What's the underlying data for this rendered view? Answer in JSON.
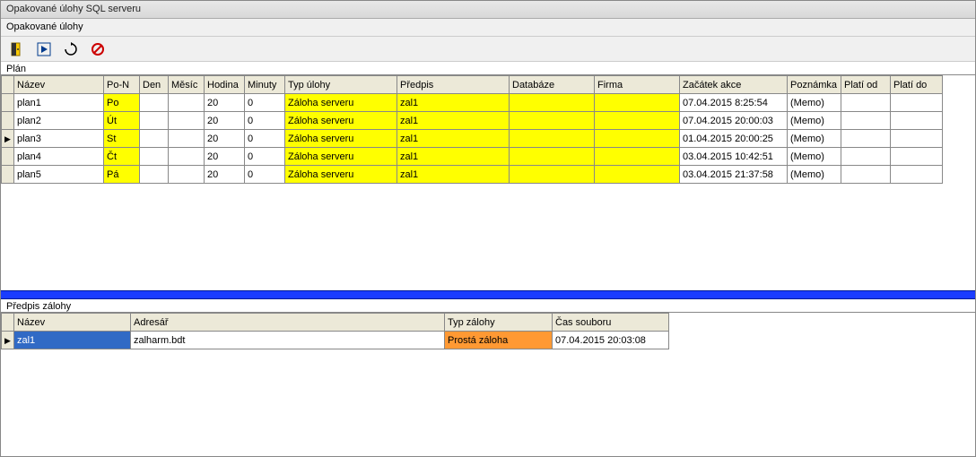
{
  "window": {
    "title": "Opakované úlohy SQL serveru"
  },
  "menu": {
    "item1": "Opakované úlohy"
  },
  "icons": {
    "exit": "exit-door-icon",
    "run": "run-forward-icon",
    "refresh": "refresh-icon",
    "forbid": "no-entry-icon"
  },
  "section1_label": "Plán",
  "grid1": {
    "headers": [
      "Název",
      "Po-N",
      "Den",
      "Měsíc",
      "Hodina",
      "Minuty",
      "Typ úlohy",
      "Předpis",
      "Databáze",
      "Firma",
      "Začátek akce",
      "Poznámka",
      "Platí od",
      "Platí do"
    ],
    "rows": [
      {
        "marker": false,
        "nazev": "plan1",
        "pon": "Po",
        "den": "",
        "mesic": "",
        "hod": "20",
        "min": "0",
        "typ": "Záloha serveru",
        "predpis": "zal1",
        "db": "",
        "firma": "",
        "start": "07.04.2015 8:25:54",
        "pozn": "(Memo)",
        "od": "",
        "do": ""
      },
      {
        "marker": false,
        "nazev": "plan2",
        "pon": "Út",
        "den": "",
        "mesic": "",
        "hod": "20",
        "min": "0",
        "typ": "Záloha serveru",
        "predpis": "zal1",
        "db": "",
        "firma": "",
        "start": "07.04.2015 20:00:03",
        "pozn": "(Memo)",
        "od": "",
        "do": ""
      },
      {
        "marker": true,
        "nazev": "plan3",
        "pon": "St",
        "den": "",
        "mesic": "",
        "hod": "20",
        "min": "0",
        "typ": "Záloha serveru",
        "predpis": "zal1",
        "db": "",
        "firma": "",
        "start": "01.04.2015 20:00:25",
        "pozn": "(Memo)",
        "od": "",
        "do": ""
      },
      {
        "marker": false,
        "nazev": "plan4",
        "pon": "Čt",
        "den": "",
        "mesic": "",
        "hod": "20",
        "min": "0",
        "typ": "Záloha serveru",
        "predpis": "zal1",
        "db": "",
        "firma": "",
        "start": "03.04.2015 10:42:51",
        "pozn": "(Memo)",
        "od": "",
        "do": ""
      },
      {
        "marker": false,
        "nazev": "plan5",
        "pon": "Pá",
        "den": "",
        "mesic": "",
        "hod": "20",
        "min": "0",
        "typ": "Záloha serveru",
        "predpis": "zal1",
        "db": "",
        "firma": "",
        "start": "03.04.2015 21:37:58",
        "pozn": "(Memo)",
        "od": "",
        "do": ""
      }
    ]
  },
  "section2_label": "Předpis zálohy",
  "grid2": {
    "headers": [
      "Název",
      "Adresář",
      "Typ zálohy",
      "Čas souboru"
    ],
    "rows": [
      {
        "marker": true,
        "nazev": "zal1",
        "adresar": "zalharm.bdt",
        "typ": "Prostá záloha",
        "cas": "07.04.2015 20:03:08",
        "selected": true
      }
    ]
  }
}
